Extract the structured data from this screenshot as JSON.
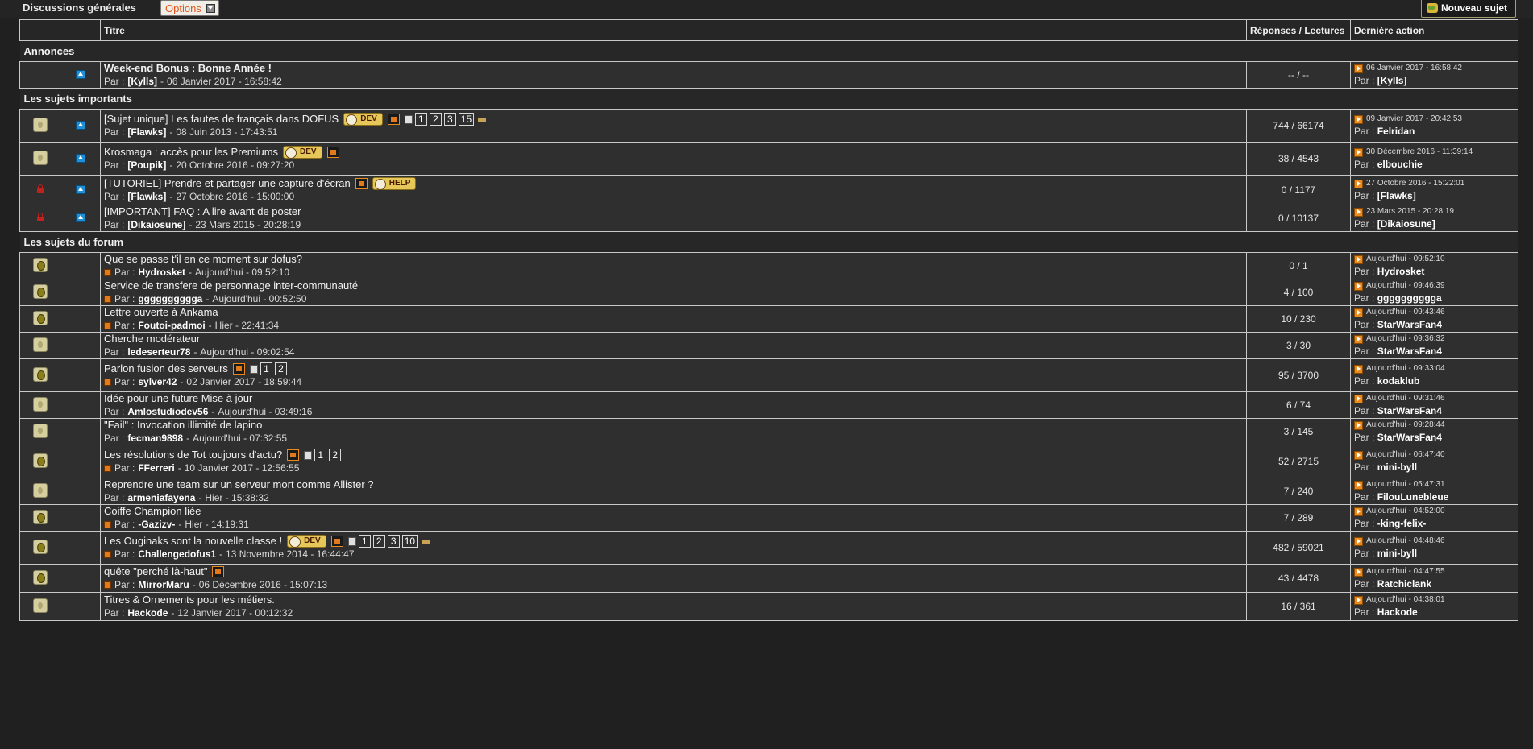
{
  "header": {
    "title": "Discussions générales",
    "options_label": "Options",
    "new_topic_label": "Nouveau sujet"
  },
  "columns": {
    "title": "Titre",
    "counts": "Réponses / Lectures",
    "last_action": "Dernière action"
  },
  "sections": [
    {
      "label": "Annonces",
      "rows": [
        {
          "status": "none",
          "mark": "pin",
          "title": "Week-end Bonus : Bonne Année !",
          "title_bold": true,
          "new": false,
          "badges": [],
          "pages": [],
          "author": "[Kylls]",
          "date": "06 Janvier 2017 - 16:58:42",
          "counts": "-- / --",
          "last_date": "06 Janvier 2017 - 16:58:42",
          "last_by": "[Kylls]"
        }
      ]
    },
    {
      "label": "Les sujets importants",
      "rows": [
        {
          "status": "plain",
          "mark": "pin",
          "title": "[Sujet unique] Les fautes de français dans DOFUS",
          "title_bold": false,
          "new": false,
          "badges": [
            "DEV",
            "gift"
          ],
          "pages": [
            "1",
            "2",
            "3",
            "15"
          ],
          "author": "[Flawks]",
          "date": "08 Juin 2013 - 17:43:51",
          "counts": "744 / 66174",
          "last_date": "09 Janvier 2017 - 20:42:53",
          "last_by": "Felridan"
        },
        {
          "status": "plain",
          "mark": "pin",
          "title": "Krosmaga : accès pour les Premiums",
          "title_bold": false,
          "new": false,
          "badges": [
            "DEV",
            "gift"
          ],
          "pages": [],
          "author": "[Poupik]",
          "date": "20 Octobre 2016 - 09:27:20",
          "counts": "38 / 4543",
          "last_date": "30 Décembre 2016 - 11:39:14",
          "last_by": "elbouchie"
        },
        {
          "status": "lock",
          "mark": "pin",
          "title": "[TUTORIEL] Prendre et partager une capture d'écran",
          "title_bold": false,
          "new": false,
          "badges": [
            "gift",
            "HELP"
          ],
          "pages": [],
          "author": "[Flawks]",
          "date": "27 Octobre 2016 - 15:00:00",
          "counts": "0 / 1177",
          "last_date": "27 Octobre 2016 - 15:22:01",
          "last_by": "[Flawks]"
        },
        {
          "status": "lock",
          "mark": "pin",
          "title": "[IMPORTANT] FAQ : A lire avant de poster",
          "title_bold": false,
          "new": false,
          "badges": [],
          "pages": [],
          "author": "[Dikaiosune]",
          "date": "23 Mars 2015 - 20:28:19",
          "counts": "0 / 10137",
          "last_date": "23 Mars 2015 - 20:28:19",
          "last_by": "[Dikaiosune]"
        }
      ]
    },
    {
      "label": "Les sujets du forum",
      "rows": [
        {
          "status": "hot",
          "mark": "",
          "title": "Que se passe t'il en ce moment sur dofus?",
          "title_bold": false,
          "new": true,
          "badges": [],
          "pages": [],
          "author": "Hydrosket",
          "date": "Aujourd'hui - 09:52:10",
          "counts": "0 / 1",
          "last_date": "Aujourd'hui - 09:52:10",
          "last_by": "Hydrosket"
        },
        {
          "status": "hot",
          "mark": "",
          "title": "Service de transfere de personnage inter-communauté",
          "title_bold": false,
          "new": true,
          "badges": [],
          "pages": [],
          "author": "gggggggggga",
          "date": "Aujourd'hui - 00:52:50",
          "counts": "4 / 100",
          "last_date": "Aujourd'hui - 09:46:39",
          "last_by": "gggggggggga"
        },
        {
          "status": "hot",
          "mark": "",
          "title": "Lettre ouverte à Ankama",
          "title_bold": false,
          "new": true,
          "badges": [],
          "pages": [],
          "author": "Foutoi-padmoi",
          "date": "Hier - 22:41:34",
          "counts": "10 / 230",
          "last_date": "Aujourd'hui - 09:43:46",
          "last_by": "StarWarsFan4"
        },
        {
          "status": "plain",
          "mark": "",
          "title": "Cherche modérateur",
          "title_bold": false,
          "new": false,
          "badges": [],
          "pages": [],
          "author": "ledeserteur78",
          "date": "Aujourd'hui - 09:02:54",
          "counts": "3 / 30",
          "last_date": "Aujourd'hui - 09:36:32",
          "last_by": "StarWarsFan4"
        },
        {
          "status": "hot",
          "mark": "",
          "title": "Parlon fusion des serveurs",
          "title_bold": false,
          "new": true,
          "badges": [
            "gift"
          ],
          "pages": [
            "1",
            "2"
          ],
          "author": "sylver42",
          "date": "02 Janvier 2017 - 18:59:44",
          "counts": "95 / 3700",
          "last_date": "Aujourd'hui - 09:33:04",
          "last_by": "kodaklub"
        },
        {
          "status": "plain",
          "mark": "",
          "title": "Idée pour une future Mise à jour",
          "title_bold": false,
          "new": false,
          "badges": [],
          "pages": [],
          "author": "Amlostudiodev56",
          "date": "Aujourd'hui - 03:49:16",
          "counts": "6 / 74",
          "last_date": "Aujourd'hui - 09:31:46",
          "last_by": "StarWarsFan4"
        },
        {
          "status": "plain",
          "mark": "",
          "title": "\"Fail\" : Invocation illimité de lapino",
          "title_bold": false,
          "new": false,
          "badges": [],
          "pages": [],
          "author": "fecman9898",
          "date": "Aujourd'hui - 07:32:55",
          "counts": "3 / 145",
          "last_date": "Aujourd'hui - 09:28:44",
          "last_by": "StarWarsFan4"
        },
        {
          "status": "hot",
          "mark": "",
          "title": "Les résolutions de Tot toujours d'actu?",
          "title_bold": false,
          "new": true,
          "badges": [
            "gift"
          ],
          "pages": [
            "1",
            "2"
          ],
          "author": "FFerreri",
          "date": "10 Janvier 2017 - 12:56:55",
          "counts": "52 / 2715",
          "last_date": "Aujourd'hui - 06:47:40",
          "last_by": "mini-byll"
        },
        {
          "status": "plain",
          "mark": "",
          "title": "Reprendre une team sur un serveur mort comme Allister ?",
          "title_bold": false,
          "new": false,
          "badges": [],
          "pages": [],
          "author": "armeniafayena",
          "date": "Hier - 15:38:32",
          "counts": "7 / 240",
          "last_date": "Aujourd'hui - 05:47:31",
          "last_by": "FilouLunebleue"
        },
        {
          "status": "hot",
          "mark": "",
          "title": "Coiffe Champion liée",
          "title_bold": false,
          "new": true,
          "badges": [],
          "pages": [],
          "author": "-Gazizv-",
          "date": "Hier - 14:19:31",
          "counts": "7 / 289",
          "last_date": "Aujourd'hui - 04:52:00",
          "last_by": "-king-felix-"
        },
        {
          "status": "hot",
          "mark": "",
          "title": "Les Ouginaks sont la nouvelle classe !",
          "title_bold": false,
          "new": true,
          "badges": [
            "DEV",
            "gift"
          ],
          "pages": [
            "1",
            "2",
            "3",
            "10"
          ],
          "author": "Challengedofus1",
          "date": "13 Novembre 2014 - 16:44:47",
          "counts": "482 / 59021",
          "last_date": "Aujourd'hui - 04:48:46",
          "last_by": "mini-byll"
        },
        {
          "status": "hot",
          "mark": "",
          "title": "quête \"perché là-haut\"",
          "title_bold": false,
          "new": true,
          "badges": [
            "gift"
          ],
          "pages": [],
          "author": "MirrorMaru",
          "date": "06 Décembre 2016 - 15:07:13",
          "counts": "43 / 4478",
          "last_date": "Aujourd'hui - 04:47:55",
          "last_by": "Ratchiclank"
        },
        {
          "status": "plain",
          "mark": "",
          "title": "Titres & Ornements pour les métiers.",
          "title_bold": false,
          "new": false,
          "badges": [],
          "pages": [],
          "author": "Hackode",
          "date": "12 Janvier 2017 - 00:12:32",
          "counts": "16 / 361",
          "last_date": "Aujourd'hui - 04:38:01",
          "last_by": "Hackode"
        }
      ]
    }
  ],
  "labels": {
    "par": "Par :"
  }
}
